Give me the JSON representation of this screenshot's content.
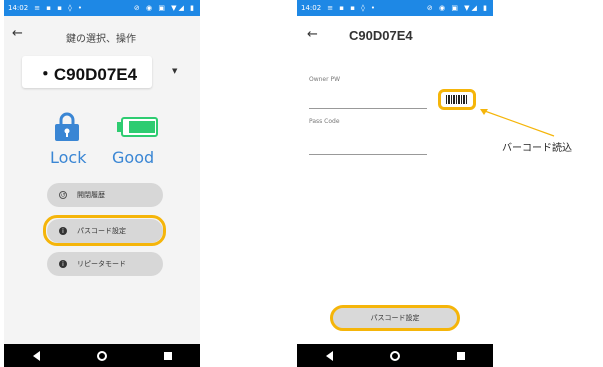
{
  "screen1": {
    "status_time": "14:02",
    "title": "鍵の選択、操作",
    "device_id": "・C90D07E4",
    "lock_state": "Lock",
    "battery_state": "Good",
    "buttons": [
      {
        "label": "開閉履歴",
        "icon": "history-icon"
      },
      {
        "label": "パスコード設定",
        "icon": "info-icon"
      },
      {
        "label": "リピータモード",
        "icon": "info-icon"
      }
    ]
  },
  "screen2": {
    "status_time": "14:02",
    "title": "C90D07E4",
    "owner_pw_label": "Owner PW",
    "pass_code_label": "Pass Code",
    "submit_label": "パスコード設定"
  },
  "annotation": {
    "barcode_text": "バーコード読込"
  },
  "colors": {
    "status_bar": "#1e88e5",
    "accent": "#3a86d4",
    "highlight": "#f5b50a",
    "battery": "#2ecc71"
  }
}
